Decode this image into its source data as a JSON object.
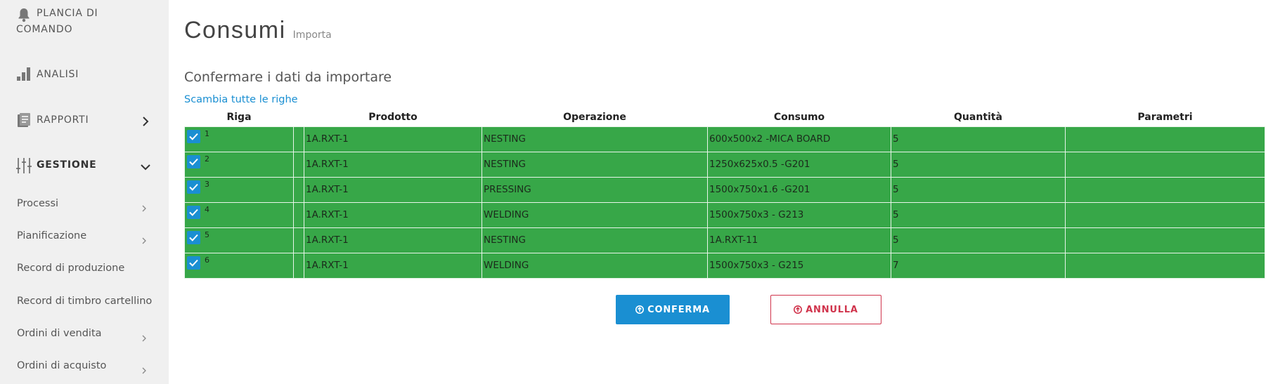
{
  "sidebar": {
    "dashboard_label_1": "PLANCIA DI",
    "dashboard_label_2": "COMANDO",
    "analysis_label": "ANALISI",
    "reports_label": "RAPPORTI",
    "management_label": "GESTIONE",
    "sub_items": [
      {
        "label": "Processi",
        "icon": "chevron-right-icon"
      },
      {
        "label": "Pianificazione",
        "icon": "chevron-right-icon"
      },
      {
        "label": "Record di produzione"
      },
      {
        "label": "Record di timbro cartellino"
      },
      {
        "label": "Ordini di vendita",
        "icon": "chevron-right-icon"
      },
      {
        "label": "Ordini di acquisto",
        "icon": "chevron-right-icon"
      }
    ]
  },
  "page": {
    "title": "Consumi",
    "subtitle": "Importa",
    "section_title": "Confermare i dati da importare",
    "swap_link": "Scambia tutte le righe"
  },
  "table": {
    "headers": {
      "riga": "Riga",
      "prodotto": "Prodotto",
      "operazione": "Operazione",
      "consumo": "Consumo",
      "quantita": "Quantità",
      "parametri": "Parametri"
    },
    "rows": [
      {
        "riga": "1",
        "prodotto": "1A.RXT-1",
        "operazione": "NESTING",
        "consumo": "600x500x2 -MICA BOARD",
        "quantita": "5",
        "parametri": ""
      },
      {
        "riga": "2",
        "prodotto": "1A.RXT-1",
        "operazione": "NESTING",
        "consumo": "1250x625x0.5 -G201",
        "quantita": "5",
        "parametri": ""
      },
      {
        "riga": "3",
        "prodotto": "1A.RXT-1",
        "operazione": "PRESSING",
        "consumo": "1500x750x1.6 -G201",
        "quantita": "5",
        "parametri": ""
      },
      {
        "riga": "4",
        "prodotto": "1A.RXT-1",
        "operazione": "WELDING",
        "consumo": "1500x750x3 - G213",
        "quantita": "5",
        "parametri": ""
      },
      {
        "riga": "5",
        "prodotto": "1A.RXT-1",
        "operazione": "NESTING",
        "consumo": "1A.RXT-11",
        "quantita": "5",
        "parametri": ""
      },
      {
        "riga": "6",
        "prodotto": "1A.RXT-1",
        "operazione": "WELDING",
        "consumo": "1500x750x3 - G215",
        "quantita": "7",
        "parametri": ""
      }
    ],
    "row_color": "#37a748",
    "checkbox_color": "#1a8fd2"
  },
  "buttons": {
    "confirm": "CONFERMA",
    "cancel": "ANNULLA"
  },
  "colors": {
    "accent": "#1a8fd2",
    "danger": "#d0344c",
    "sidebar_bg": "#f0f0f0"
  }
}
